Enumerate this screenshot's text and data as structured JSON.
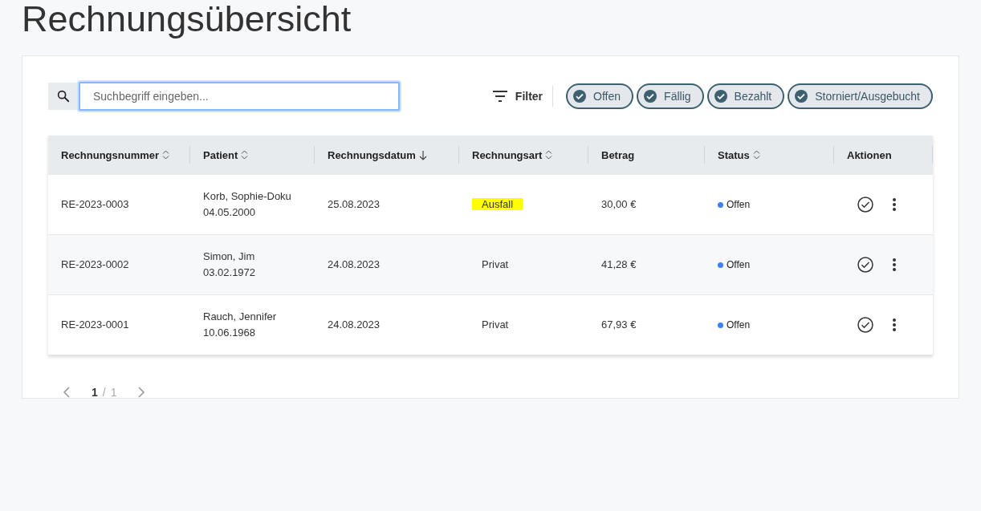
{
  "title": "Rechnungsübersicht",
  "search": {
    "placeholder": "Suchbegriff eingeben..."
  },
  "filter": {
    "label": "Filter"
  },
  "chips": [
    {
      "label": "Offen",
      "checked": true
    },
    {
      "label": "Fällig",
      "checked": true
    },
    {
      "label": "Bezahlt",
      "checked": true
    },
    {
      "label": "Storniert/Ausgebucht",
      "checked": true
    }
  ],
  "table": {
    "columns": [
      {
        "label": "Rechnungsnummer",
        "kind": "sortable"
      },
      {
        "label": "Patient",
        "kind": "sortable"
      },
      {
        "label": "Rechnungsdatum",
        "kind": "descending"
      },
      {
        "label": "Rechnungsart",
        "kind": "sortable"
      },
      {
        "label": "Betrag",
        "kind": "plain"
      },
      {
        "label": "Status",
        "kind": "sortable"
      },
      {
        "label": "Aktionen",
        "kind": "plain"
      }
    ],
    "rows": [
      {
        "number": "RE-2023-0003",
        "patient": "Korb, Sophie-Doku",
        "birthdate": "04.05.2000",
        "date": "25.08.2023",
        "type": "Ausfall",
        "highlighted": true,
        "amount": "30,00 €",
        "status": "Offen",
        "color": "#3b82f6"
      },
      {
        "number": "RE-2023-0002",
        "patient": "Simon, Jim",
        "birthdate": "03.02.1972",
        "date": "24.08.2023",
        "type": "Privat",
        "highlighted": false,
        "amount": "41,28 €",
        "status": "Offen",
        "color": "#3b82f6"
      },
      {
        "number": "RE-2023-0001",
        "patient": "Rauch, Jennifer",
        "birthdate": "10.06.1968",
        "date": "24.08.2023",
        "type": "Privat",
        "highlighted": false,
        "amount": "67,93 €",
        "status": "Offen",
        "color": "#3b82f6"
      }
    ]
  },
  "pagination": {
    "current": "1",
    "separator": "/",
    "total": "1"
  }
}
